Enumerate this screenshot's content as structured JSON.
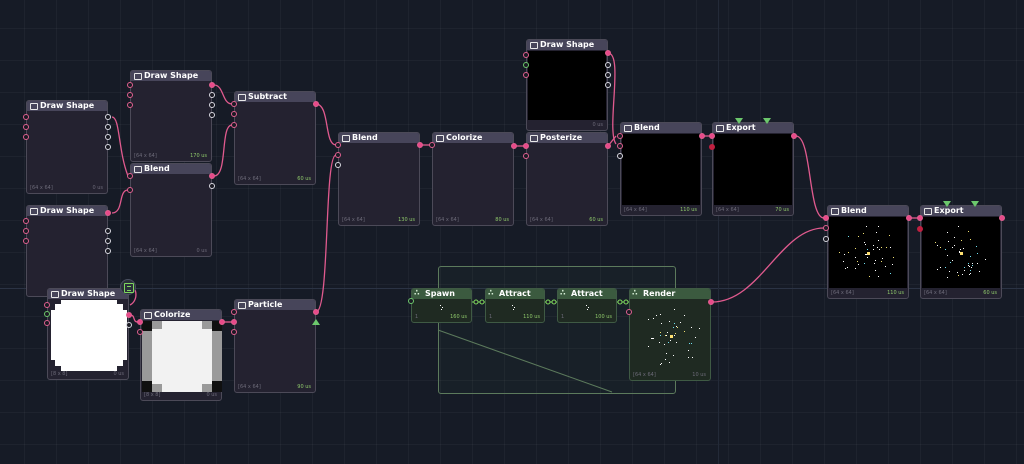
{
  "nodes": [
    {
      "id": "ds1",
      "title": "Draw Shape",
      "dims": "[64 x 64]",
      "time": "0 us"
    },
    {
      "id": "ds2",
      "title": "Draw Shape",
      "dims": "[64 x 64]",
      "time": "170 us"
    },
    {
      "id": "bl1",
      "title": "Blend",
      "dims": "[64 x 64]",
      "time": "0 us"
    },
    {
      "id": "ds3",
      "title": "Draw Shape",
      "dims": "",
      "time": ""
    },
    {
      "id": "sub",
      "title": "Subtract",
      "dims": "[64 x 64]",
      "time": "60 us"
    },
    {
      "id": "bl2",
      "title": "Blend",
      "dims": "[64 x 64]",
      "time": "130 us"
    },
    {
      "id": "col1",
      "title": "Colorize",
      "dims": "[64 x 64]",
      "time": "80 us"
    },
    {
      "id": "ds4",
      "title": "Draw Shape",
      "dims": "",
      "time": "0 us"
    },
    {
      "id": "post",
      "title": "Posterize",
      "dims": "[64 x 64]",
      "time": "60 us"
    },
    {
      "id": "bl3",
      "title": "Blend",
      "dims": "[64 x 64]",
      "time": "110 us"
    },
    {
      "id": "exp1",
      "title": "Export",
      "dims": "[64 x 64]",
      "time": "70 us"
    },
    {
      "id": "bl4",
      "title": "Blend",
      "dims": "[64 x 64]",
      "time": "110 us"
    },
    {
      "id": "exp2",
      "title": "Export",
      "dims": "[64 x 64]",
      "time": "60 us"
    },
    {
      "id": "ds5",
      "title": "Draw Shape",
      "dims": "[8 x 8]",
      "time": "0 us"
    },
    {
      "id": "col2",
      "title": "Colorize",
      "dims": "[8 x 8]",
      "time": "0 us"
    },
    {
      "id": "part",
      "title": "Particle",
      "dims": "[64 x 64]",
      "time": "90 us"
    },
    {
      "id": "spawn",
      "title": "Spawn",
      "dims": "1",
      "time": "160 us"
    },
    {
      "id": "att1",
      "title": "Attract",
      "dims": "1",
      "time": "110 us"
    },
    {
      "id": "att2",
      "title": "Attract",
      "dims": "1",
      "time": "100 us"
    },
    {
      "id": "rend",
      "title": "Render",
      "dims": "[64 x 64]",
      "time": "10 us"
    }
  ],
  "icons": {
    "header": "image-node-icon",
    "particle_header": "particle-node-icon",
    "note": "note-icon"
  },
  "colors": {
    "wire": "#e05a8e",
    "particle_wire": "#7ed85e",
    "background": "#161b26",
    "node": "#242230",
    "node_header": "#47455a"
  }
}
